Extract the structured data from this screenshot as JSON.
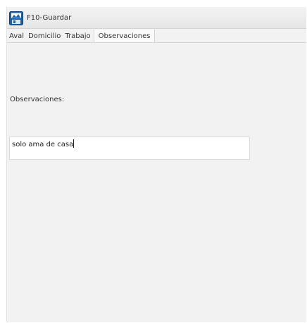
{
  "toolbar": {
    "save_label": "F10-Guardar",
    "save_icon": "save-floppy-icon"
  },
  "tabs": [
    {
      "label": "Aval",
      "active": false
    },
    {
      "label": "Domicilio",
      "active": false
    },
    {
      "label": "Trabajo",
      "active": false
    },
    {
      "label": "Observaciones",
      "active": true
    }
  ],
  "observaciones": {
    "label": "Observaciones:",
    "value": "solo ama de casa"
  },
  "colors": {
    "icon_blue": "#1f5fa8",
    "panel_bg": "#f2f2f2"
  }
}
